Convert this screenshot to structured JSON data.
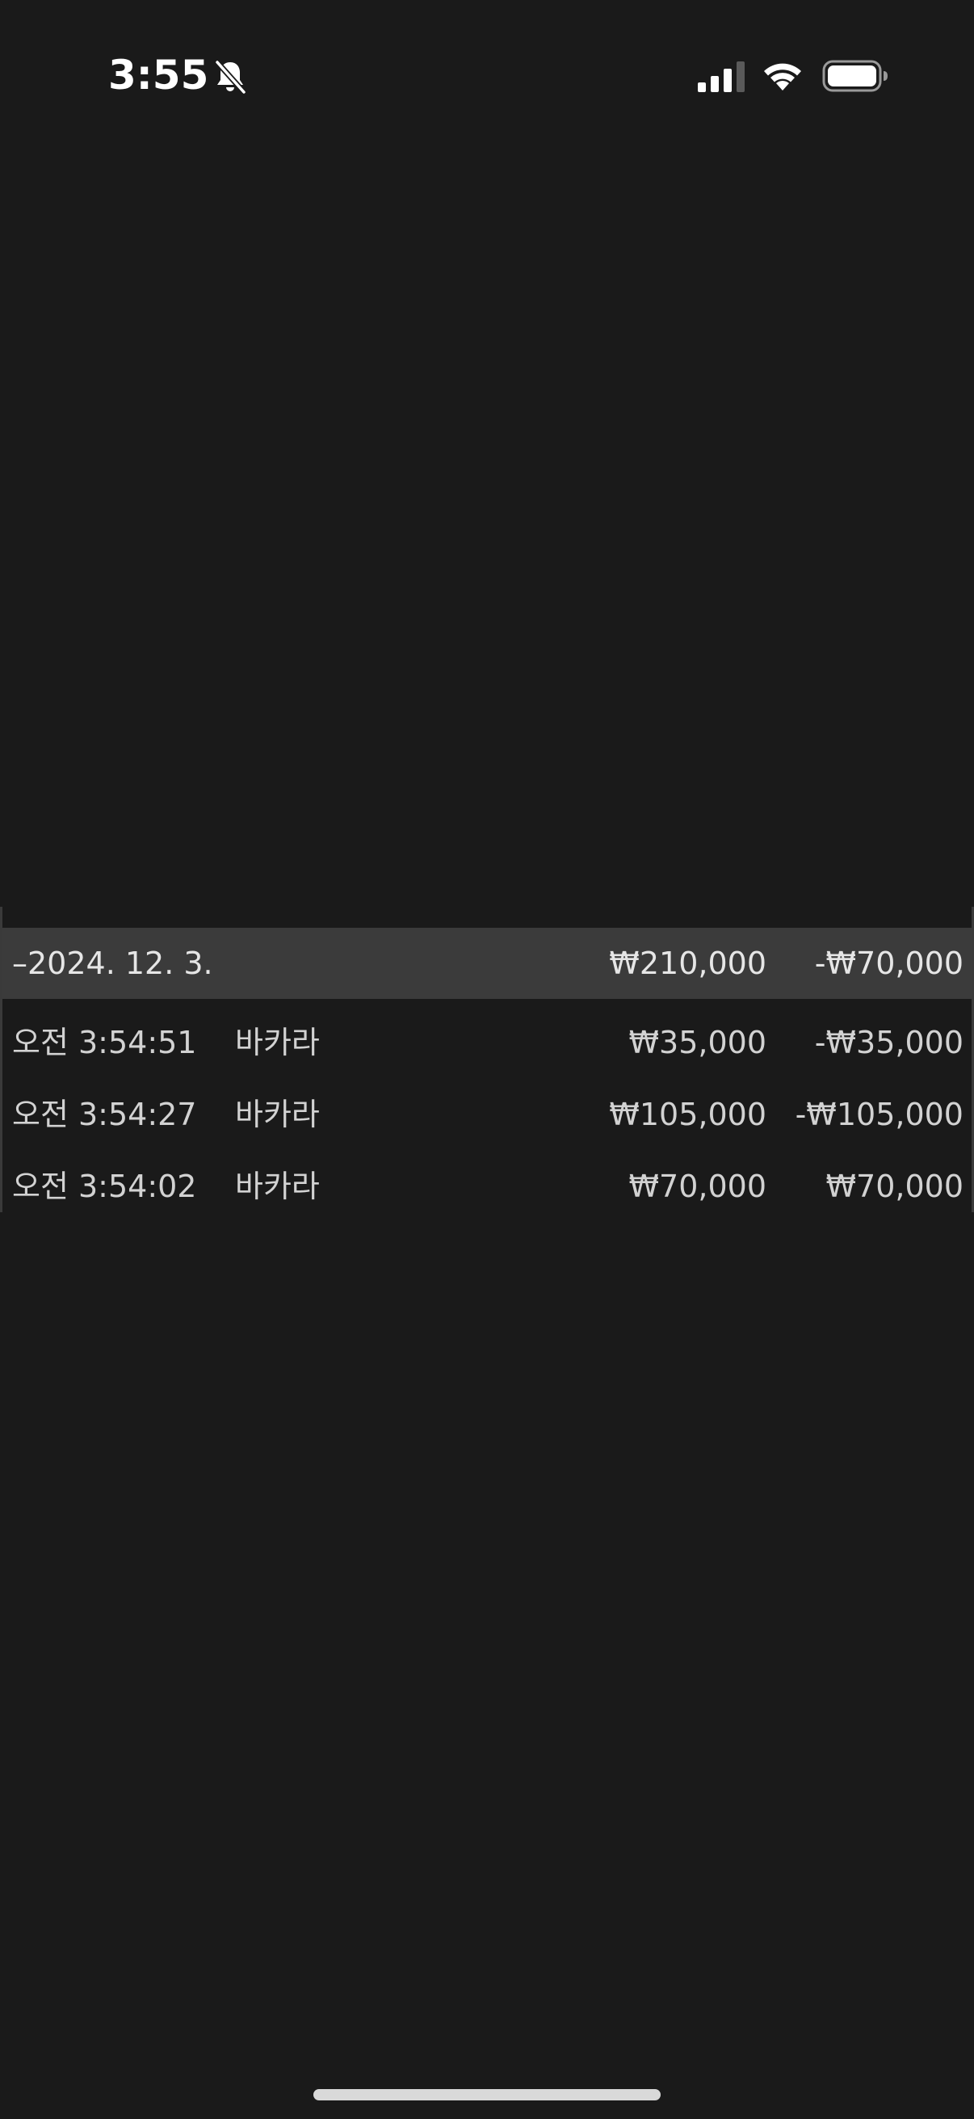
{
  "status_bar": {
    "time": "3:55",
    "icons": [
      "bell-slash-icon",
      "cellular-signal-icon",
      "wifi-icon",
      "battery-icon"
    ]
  },
  "transactions": {
    "group": {
      "date": "–2024. 12. 3.",
      "total_bet": "₩210,000",
      "total_result": "-₩70,000"
    },
    "rows": [
      {
        "time": "오전 3:54:51",
        "game": "바카라",
        "bet": "₩35,000",
        "result": "-₩35,000"
      },
      {
        "time": "오전 3:54:27",
        "game": "바카라",
        "bet": "₩105,000",
        "result": "-₩105,000"
      },
      {
        "time": "오전 3:54:02",
        "game": "바카라",
        "bet": "₩70,000",
        "result": "₩70,000"
      }
    ]
  },
  "colors": {
    "background": "#1a1a1a",
    "header_row": "#3b3b3b",
    "text": "#d2d2d2"
  }
}
